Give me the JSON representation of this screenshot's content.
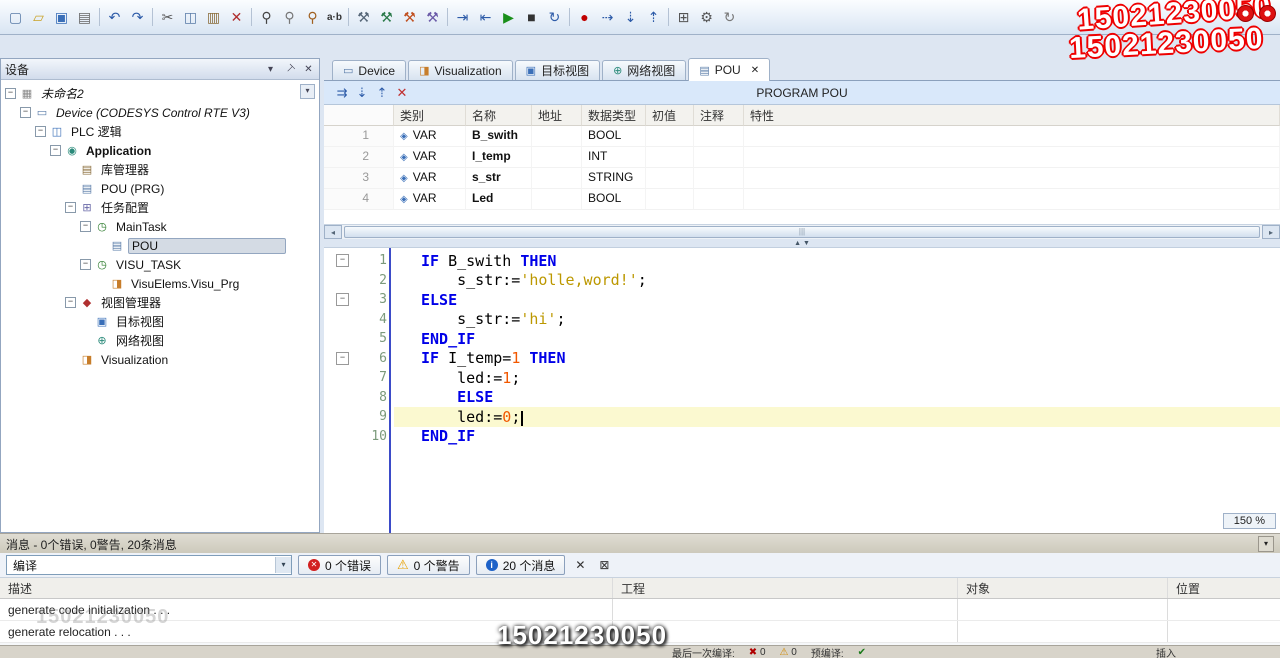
{
  "window": {
    "watermark_phone": "15021230050"
  },
  "toolbar": {
    "items": [
      {
        "name": "new-file-icon",
        "glyph": "▢",
        "color": "#5a7ca8"
      },
      {
        "name": "open-file-icon",
        "glyph": "▱",
        "color": "#c9a227"
      },
      {
        "name": "save-icon",
        "glyph": "▣",
        "color": "#3a6fb8"
      },
      {
        "name": "print-icon",
        "glyph": "▤",
        "color": "#666666"
      },
      {
        "sep": true
      },
      {
        "name": "undo-icon",
        "glyph": "↶",
        "color": "#2d5ba8"
      },
      {
        "name": "redo-icon",
        "glyph": "↷",
        "color": "#2d5ba8"
      },
      {
        "sep": true
      },
      {
        "name": "cut-icon",
        "glyph": "✂",
        "color": "#555555"
      },
      {
        "name": "copy-icon",
        "glyph": "◫",
        "color": "#5a7ca8"
      },
      {
        "name": "paste-icon",
        "glyph": "▥",
        "color": "#8a6d3b"
      },
      {
        "name": "delete-icon",
        "glyph": "✕",
        "color": "#b03030"
      },
      {
        "sep": true
      },
      {
        "name": "find-icon",
        "glyph": "⚲",
        "color": "#444444"
      },
      {
        "name": "find-next-icon",
        "glyph": "⚲",
        "color": "#777777"
      },
      {
        "name": "find-in-project-icon",
        "glyph": "⚲",
        "color": "#a06020"
      },
      {
        "name": "replace-icon",
        "glyph": "a·b",
        "color": "#333333",
        "text": true
      },
      {
        "sep": true
      },
      {
        "name": "build-icon",
        "glyph": "⚒",
        "color": "#556677"
      },
      {
        "name": "rebuild-icon",
        "glyph": "⚒",
        "color": "#2a7a4a"
      },
      {
        "name": "generate-code-icon",
        "glyph": "⚒",
        "color": "#c05020"
      },
      {
        "name": "clean-all-icon",
        "glyph": "⚒",
        "color": "#6a5aa8"
      },
      {
        "sep": true
      },
      {
        "name": "login-icon",
        "glyph": "⇥",
        "color": "#2d5ba8"
      },
      {
        "name": "logout-icon",
        "glyph": "⇤",
        "color": "#2d5ba8"
      },
      {
        "name": "start-icon",
        "glyph": "▶",
        "color": "#1a8f1a"
      },
      {
        "name": "stop-icon",
        "glyph": "■",
        "color": "#333333"
      },
      {
        "name": "single-cycle-icon",
        "glyph": "↻",
        "color": "#2d5ba8"
      },
      {
        "sep": true
      },
      {
        "name": "breakpoint-icon",
        "glyph": "●",
        "color": "#c00000"
      },
      {
        "name": "step-over-icon",
        "glyph": "⇢",
        "color": "#2d5ba8"
      },
      {
        "name": "step-into-icon",
        "glyph": "⇣",
        "color": "#2d5ba8"
      },
      {
        "name": "step-out-icon",
        "glyph": "⇡",
        "color": "#2d5ba8"
      },
      {
        "sep": true
      },
      {
        "name": "window-list-icon",
        "glyph": "⊞",
        "color": "#555555"
      },
      {
        "name": "options-icon",
        "glyph": "⚙",
        "color": "#555555"
      },
      {
        "name": "refresh-icon",
        "glyph": "↻",
        "color": "#777777"
      }
    ]
  },
  "devices_panel": {
    "title": "设备",
    "items": [
      {
        "id": "project-unnamed2",
        "label": "未命名2",
        "level": 0,
        "icon": "project",
        "glyph": "▦",
        "icon_color": "#888888",
        "children": true,
        "italic": true
      },
      {
        "id": "device",
        "label": "Device (CODESYS Control RTE V3)",
        "level": 1,
        "icon": "device",
        "glyph": "▭",
        "icon_color": "#5a7ca8",
        "children": true,
        "italic": true
      },
      {
        "id": "plc-logic",
        "label": "PLC 逻辑",
        "level": 2,
        "icon": "plc-logic",
        "glyph": "◫",
        "icon_color": "#3a6fb8",
        "children": true
      },
      {
        "id": "application",
        "label": "Application",
        "level": 3,
        "icon": "application",
        "glyph": "◉",
        "icon_color": "#2a8a7a",
        "children": true,
        "bold": true
      },
      {
        "id": "library-manager",
        "label": "库管理器",
        "level": 4,
        "icon": "library",
        "glyph": "▤",
        "icon_color": "#8a6d3b"
      },
      {
        "id": "pou-prg",
        "label": "POU (PRG)",
        "level": 4,
        "icon": "pou",
        "glyph": "▤",
        "icon_color": "#5a7ca8"
      },
      {
        "id": "task-configuration",
        "label": "任务配置",
        "level": 4,
        "icon": "task-config",
        "glyph": "⊞",
        "icon_color": "#6a6aa8",
        "children": true
      },
      {
        "id": "maintask",
        "label": "MainTask",
        "level": 5,
        "icon": "task",
        "glyph": "◷",
        "icon_color": "#2a7a2a",
        "children": true
      },
      {
        "id": "pou-call",
        "label": "POU",
        "level": 6,
        "icon": "pou",
        "glyph": "▤",
        "icon_color": "#5a7ca8",
        "selected": true
      },
      {
        "id": "visu-task",
        "label": "VISU_TASK",
        "level": 5,
        "icon": "task",
        "glyph": "◷",
        "icon_color": "#2a7a2a",
        "children": true
      },
      {
        "id": "visuelems-visu-prg",
        "label": "VisuElems.Visu_Prg",
        "level": 6,
        "icon": "visu-program",
        "glyph": "◨",
        "icon_color": "#c77d2a"
      },
      {
        "id": "view-manager",
        "label": "视图管理器",
        "level": 4,
        "icon": "view-manager",
        "glyph": "◆",
        "icon_color": "#b03030",
        "children": true
      },
      {
        "id": "target-view",
        "label": "目标视图",
        "level": 5,
        "icon": "target-view",
        "glyph": "▣",
        "icon_color": "#3a6fb8"
      },
      {
        "id": "network-view",
        "label": "网络视图",
        "level": 5,
        "icon": "network-view",
        "glyph": "⊕",
        "icon_color": "#2a8a7a"
      },
      {
        "id": "visualization",
        "label": "Visualization",
        "level": 4,
        "icon": "visualization",
        "glyph": "◨",
        "icon_color": "#c77d2a"
      }
    ]
  },
  "tabs": [
    {
      "id": "device",
      "label": "Device",
      "icon": "device",
      "glyph": "▭",
      "icon_color": "#5a7ca8"
    },
    {
      "id": "visualization",
      "label": "Visualization",
      "icon": "visualization",
      "glyph": "◨",
      "icon_color": "#c77d2a"
    },
    {
      "id": "target-view",
      "label": "目标视图",
      "icon": "target-view",
      "glyph": "▣",
      "icon_color": "#3a6fb8"
    },
    {
      "id": "network-view",
      "label": "网络视图",
      "icon": "network-view",
      "glyph": "⊕",
      "icon_color": "#2a8a7a"
    },
    {
      "id": "pou",
      "label": "POU",
      "icon": "pou",
      "glyph": "▤",
      "icon_color": "#5a7ca8",
      "active": true,
      "closable": true
    }
  ],
  "pou_editor": {
    "header": "PROGRAM POU",
    "zoom": "150 %",
    "toolbar_icons": [
      {
        "name": "goto-definition-icon",
        "glyph": "⇉",
        "color": "#2d5ba8"
      },
      {
        "name": "move-down-icon",
        "glyph": "⇣",
        "color": "#2d5ba8"
      },
      {
        "name": "move-up-icon",
        "glyph": "⇡",
        "color": "#2d5ba8"
      },
      {
        "name": "delete-row-icon",
        "glyph": "✕",
        "color": "#c03030"
      }
    ],
    "declaration": {
      "var_icon": "◈",
      "columns": [
        "类别",
        "名称",
        "地址",
        "数据类型",
        "初值",
        "注释",
        "特性"
      ],
      "rows": [
        {
          "line": "1",
          "scope": "VAR",
          "name": "B_swith",
          "address": "",
          "type": "BOOL",
          "init": "",
          "comment": "",
          "attr": ""
        },
        {
          "line": "2",
          "scope": "VAR",
          "name": "I_temp",
          "address": "",
          "type": "INT",
          "init": "",
          "comment": "",
          "attr": ""
        },
        {
          "line": "3",
          "scope": "VAR",
          "name": "s_str",
          "address": "",
          "type": "STRING",
          "init": "",
          "comment": "",
          "attr": ""
        },
        {
          "line": "4",
          "scope": "VAR",
          "name": "Led",
          "address": "",
          "type": "BOOL",
          "init": "",
          "comment": "",
          "attr": ""
        }
      ]
    },
    "code": {
      "lines": [
        {
          "num": "1",
          "fold": true,
          "tokens": [
            {
              "c": "kw",
              "t": "IF"
            },
            {
              "c": "id",
              "t": " B_swith "
            },
            {
              "c": "kw",
              "t": "THEN"
            }
          ]
        },
        {
          "num": "2",
          "tokens": [
            {
              "c": "id",
              "t": "    s_str:="
            },
            {
              "c": "str",
              "t": "'holle,word!'"
            },
            {
              "c": "id",
              "t": ";"
            }
          ]
        },
        {
          "num": "3",
          "fold": true,
          "tokens": [
            {
              "c": "kw",
              "t": "ELSE"
            }
          ]
        },
        {
          "num": "4",
          "tokens": [
            {
              "c": "id",
              "t": "    s_str:="
            },
            {
              "c": "str",
              "t": "'hi'"
            },
            {
              "c": "id",
              "t": ";"
            }
          ]
        },
        {
          "num": "5",
          "tokens": [
            {
              "c": "kw",
              "t": "END_IF"
            }
          ]
        },
        {
          "num": "6",
          "fold": true,
          "tokens": [
            {
              "c": "kw",
              "t": "IF"
            },
            {
              "c": "id",
              "t": " I_temp="
            },
            {
              "c": "num",
              "t": "1"
            },
            {
              "c": "id",
              "t": " "
            },
            {
              "c": "kw",
              "t": "THEN"
            }
          ]
        },
        {
          "num": "7",
          "tokens": [
            {
              "c": "id",
              "t": "    led:="
            },
            {
              "c": "num",
              "t": "1"
            },
            {
              "c": "id",
              "t": ";"
            }
          ]
        },
        {
          "num": "8",
          "tokens": [
            {
              "c": "id",
              "t": "    "
            },
            {
              "c": "kw",
              "t": "ELSE"
            }
          ]
        },
        {
          "num": "9",
          "current": true,
          "cursor": true,
          "tokens": [
            {
              "c": "id",
              "t": "    led:="
            },
            {
              "c": "num",
              "t": "0"
            },
            {
              "c": "id",
              "t": ";"
            }
          ]
        },
        {
          "num": "10",
          "tokens": [
            {
              "c": "kw",
              "t": "END_IF"
            }
          ]
        }
      ]
    }
  },
  "messages_bar": {
    "title": "消息 - 0个错误, 0警告, 20条消息"
  },
  "messages_panel": {
    "filter": "编译",
    "errors_label": "0 个错误",
    "warnings_label": "0 个警告",
    "infos_label": "20 个消息",
    "columns": [
      "描述",
      "工程",
      "对象",
      "位置"
    ],
    "rows": [
      {
        "description": "generate code initialization . . .",
        "project": "",
        "object": "",
        "position": ""
      },
      {
        "description": "generate relocation . . .",
        "project": "",
        "object": "",
        "position": ""
      }
    ]
  },
  "status_bar": {
    "last_build_label": "最后一次编译:",
    "error_count": "0",
    "warning_count": "0",
    "precompile_label": "预编译:",
    "precompile_ok": "✔",
    "insert_mode": "插入"
  }
}
